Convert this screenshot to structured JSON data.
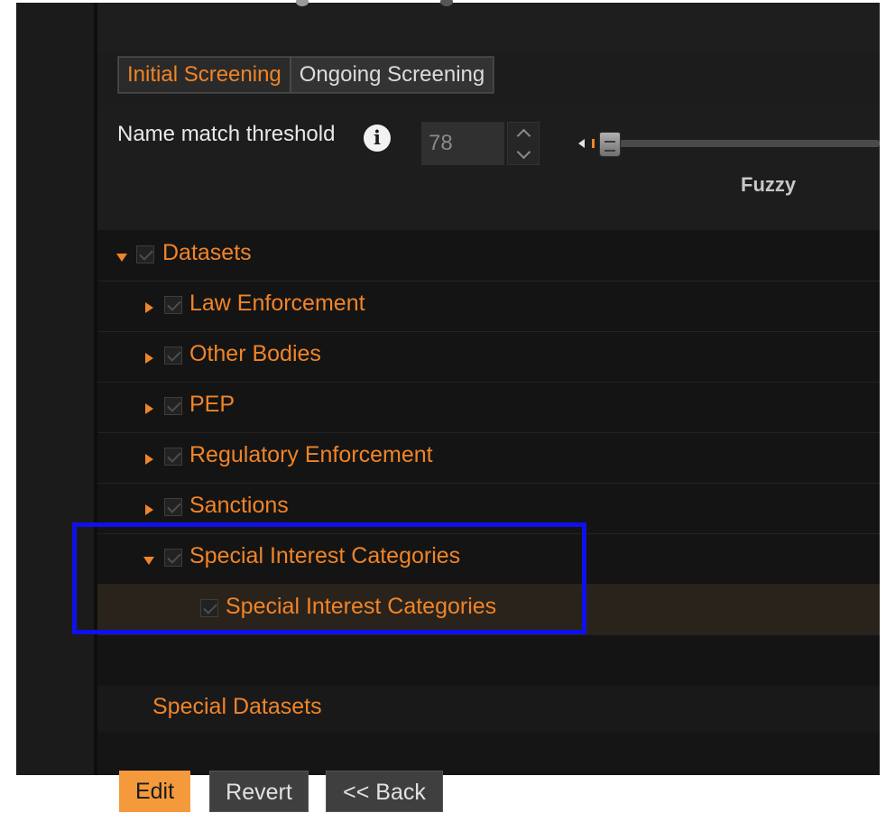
{
  "tabs": [
    {
      "label": "Initial Screening",
      "active": true
    },
    {
      "label": "Ongoing Screening",
      "active": false
    }
  ],
  "threshold": {
    "label": "Name match threshold",
    "info_icon": "info-icon",
    "value": "78",
    "slider_level_label": "Fuzzy"
  },
  "tree": {
    "root": {
      "label": "Datasets",
      "expanded": true,
      "checked": true
    },
    "items": [
      {
        "label": "Law Enforcement",
        "expanded": false,
        "checked": true
      },
      {
        "label": "Other Bodies",
        "expanded": false,
        "checked": true
      },
      {
        "label": "PEP",
        "expanded": false,
        "checked": true
      },
      {
        "label": "Regulatory Enforcement",
        "expanded": false,
        "checked": true
      },
      {
        "label": "Sanctions",
        "expanded": false,
        "checked": true
      },
      {
        "label": "Special Interest Categories",
        "expanded": true,
        "checked": true,
        "children": [
          {
            "label": "Special Interest Categories",
            "checked": true
          }
        ]
      }
    ]
  },
  "special_datasets_label": "Special Datasets",
  "buttons": {
    "edit": "Edit",
    "revert": "Revert",
    "back": "<< Back"
  },
  "colors": {
    "accent": "#f08428",
    "highlight_box": "#1010e8",
    "edit_button": "#f59a3c"
  }
}
